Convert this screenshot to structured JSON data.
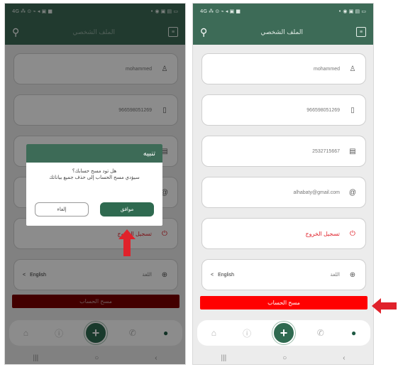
{
  "statusbar": {
    "left": "4G ⁂ ⊙ ⌁ ◂ ▣ ■",
    "right": "• ◉ ▣ ▤ ▭"
  },
  "header": {
    "title": "الملف الشخصي",
    "menu_glyph": "≡"
  },
  "fields": {
    "name": "mohammed",
    "phone": "966598051269",
    "national_id": "2532715667",
    "email": "alhabaty@gmail.com",
    "logout": "تسجيل الخروج",
    "language_label": "اللغة",
    "language_value": "English"
  },
  "delete_account": "مسح الحساب",
  "dialog": {
    "title": "تنبيه",
    "line1": "هل تود مسح حسابك؟",
    "line2": "سيؤدي مسح الحساب إلى حذف جميع بياناتك",
    "confirm": "موافق",
    "cancel": "إلغاء"
  },
  "sysnav": {
    "recents": "|||",
    "home": "○",
    "back": "‹"
  },
  "icons": {
    "user": "♙",
    "phone": "▯",
    "id": "▤",
    "email": "@",
    "power": "⏻",
    "globe": "⊕",
    "chevron": "<",
    "arrow": "⇦"
  },
  "colors": {
    "primary": "#3d6b57",
    "danger": "#ff0000",
    "arrow": "#e0222b"
  }
}
